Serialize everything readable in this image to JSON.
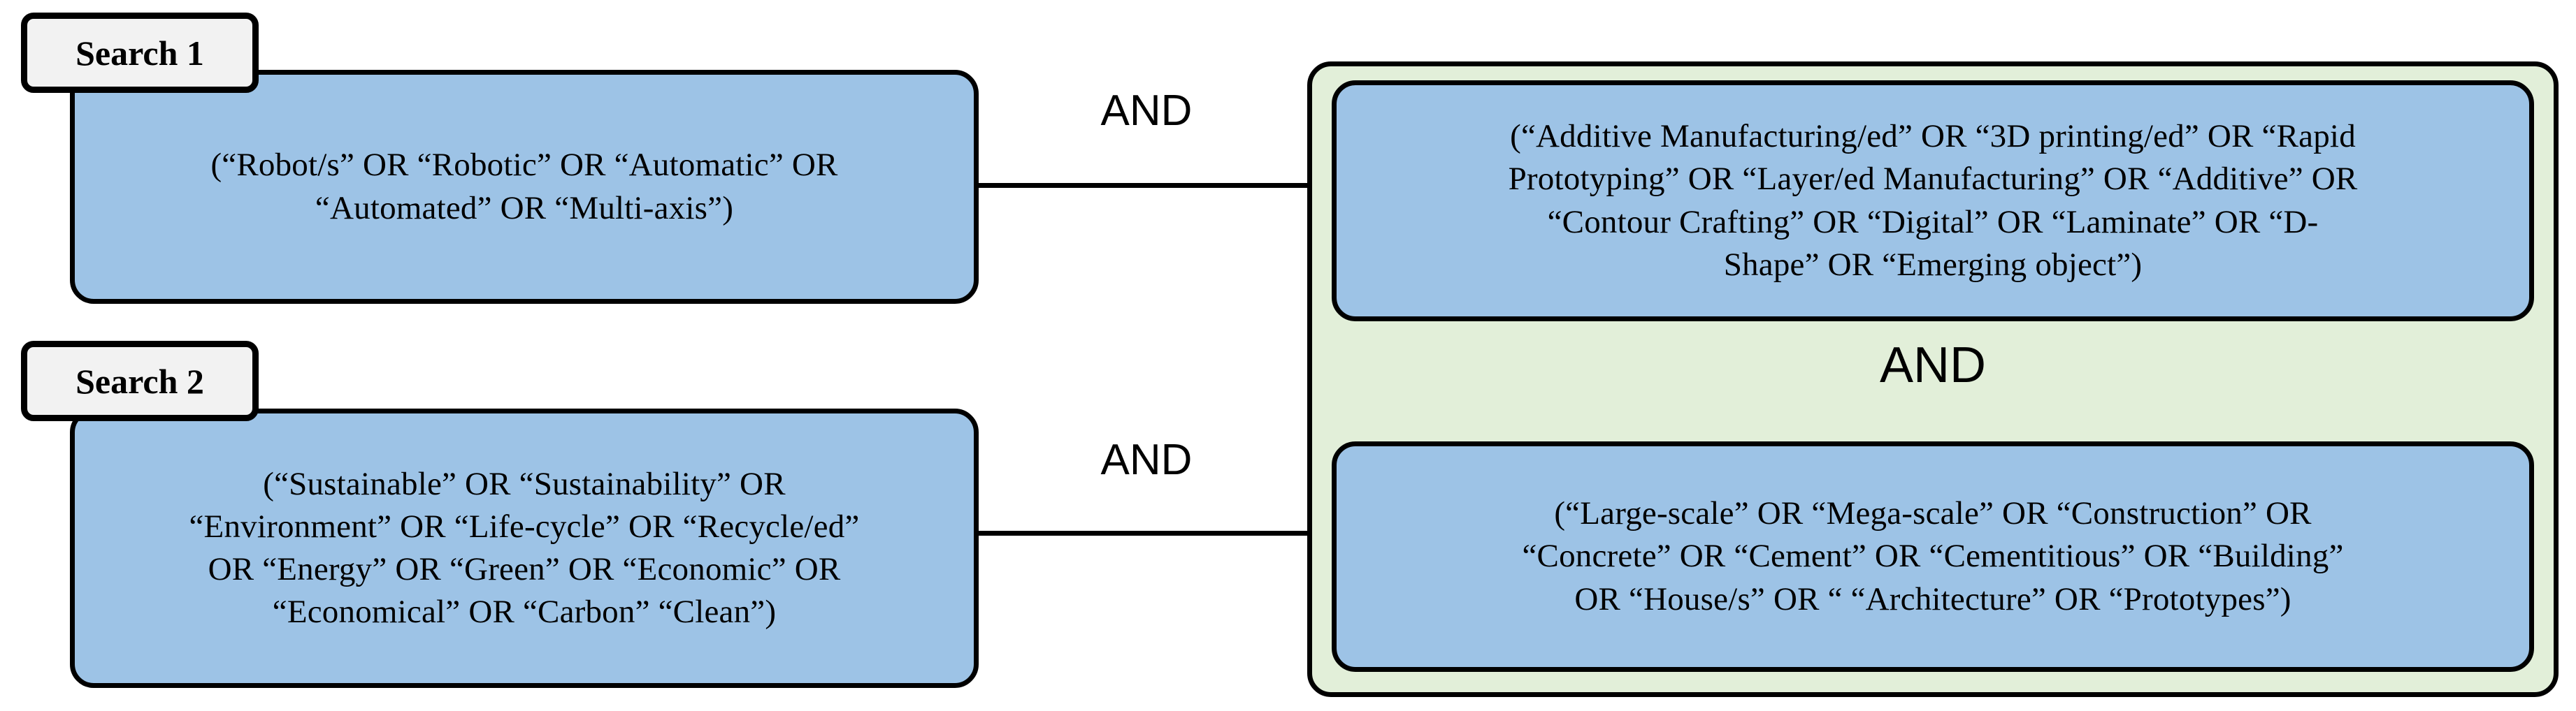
{
  "diagram": {
    "type": "search-strategy-boolean-diagram",
    "colors": {
      "query_box_fill": "#9DC3E6",
      "group_fill": "#E2EFD9",
      "label_fill": "#F2F2F2",
      "border": "#000000",
      "background": "#FFFFFF"
    },
    "left_column": {
      "rows": [
        {
          "label": "Search 1",
          "query": "(“Robot/s” OR “Robotic” OR “Automatic” OR\n“Automated” OR “Multi-axis”)",
          "operator": "AND"
        },
        {
          "label": "Search 2",
          "query": "(“Sustainable” OR “Sustainability” OR\n“Environment” OR “Life-cycle” OR “Recycle/ed”\nOR “Energy” OR “Green” OR “Economic” OR\n“Economical” OR “Carbon” “Clean”)",
          "operator": "AND"
        }
      ]
    },
    "right_group": {
      "inner_operator": "AND",
      "boxes": [
        {
          "query": "(“Additive Manufacturing/ed” OR “3D printing/ed” OR “Rapid\nPrototyping” OR “Layer/ed Manufacturing” OR “Additive” OR\n“Contour Crafting” OR “Digital” OR “Laminate” OR “D-\nShape” OR “Emerging object”)"
        },
        {
          "query": "(“Large-scale” OR “Mega-scale” OR “Construction” OR\n“Concrete” OR “Cement” OR “Cementitious” OR “Building”\nOR “House/s” OR “ “Architecture” OR “Prototypes”)"
        }
      ]
    }
  }
}
